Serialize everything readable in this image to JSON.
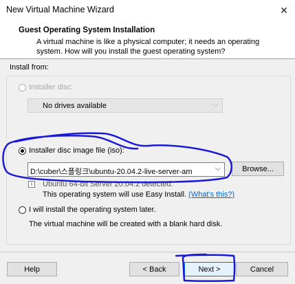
{
  "window": {
    "title": "New Virtual Machine Wizard",
    "close_glyph": "✕"
  },
  "header": {
    "title": "Guest Operating System Installation",
    "description": "A virtual machine is like a physical computer; it needs an operating system. How will you install the guest operating system?"
  },
  "install_from_label": "Install from:",
  "options": {
    "installer_disc": {
      "label": "Installer disc:",
      "selected": false,
      "enabled": false
    },
    "drive_select": {
      "value": "No drives available",
      "enabled": false
    },
    "iso": {
      "label": "Installer disc image file (iso):",
      "selected": true
    },
    "iso_path": {
      "value": "D:\\cuber\\스플링크\\ubuntu-20.04.2-live-server-am"
    },
    "browse_label": "Browse...",
    "detected_text": "Ubuntu 64-bit Server 20.04.2 detected.",
    "easy_install_text": "This operating system will use Easy Install.",
    "whats_this": "(What's this?)",
    "later": {
      "label": "I will install the operating system later.",
      "selected": false
    },
    "later_description": "The virtual machine will be created with a blank hard disk."
  },
  "footer": {
    "help_label": "Help",
    "back_label": "< Back",
    "next_label": "Next >",
    "cancel_label": "Cancel"
  },
  "colors": {
    "annotation": "#1a1ad6",
    "link": "#0066cc",
    "accent": "#0078d7"
  }
}
